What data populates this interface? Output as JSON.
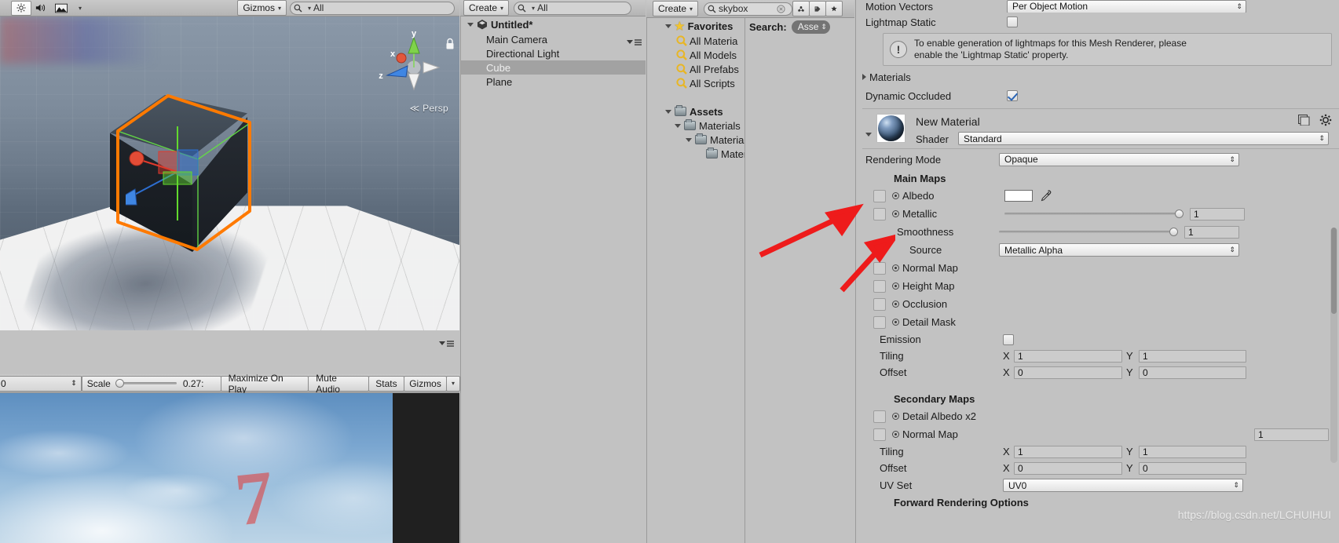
{
  "scene_toolbar": {
    "lighting_icon": "sun-icon",
    "audio_icon": "speaker-icon",
    "fx_icon": "image-icon",
    "fx_caret": "▾",
    "gizmos_label": "Gizmos",
    "gizmos_caret": "▾",
    "search_placeholder": "All",
    "search_value": "",
    "search_icon": "search-icon"
  },
  "scene_view": {
    "projection_label": "Persp",
    "projection_prefix": "≪",
    "axis_x": "x",
    "axis_y": "y",
    "axis_z": "z",
    "selection_color": "#ff7a00",
    "wire_color": "#66dd44"
  },
  "game_toolbar": {
    "display_value": "0",
    "scale_label": "Scale",
    "scale_value": "0.27:",
    "maximize_label": "Maximize On Play",
    "mute_label": "Mute Audio",
    "stats_label": "Stats",
    "gizmos_label": "Gizmos",
    "gizmos_caret": "▾",
    "options_icon": "panel-options-icon"
  },
  "game_view": {
    "overlay_number": "7"
  },
  "hierarchy": {
    "create_label": "Create",
    "create_caret": "▾",
    "search_placeholder": "All",
    "search_icon": "search-icon",
    "options_icon": "panel-options-icon",
    "scene_name": "Untitled*",
    "scene_icon": "unity-scene-icon",
    "items": [
      {
        "label": "Main Camera",
        "selected": false
      },
      {
        "label": "Directional Light",
        "selected": false
      },
      {
        "label": "Cube",
        "selected": true
      },
      {
        "label": "Plane",
        "selected": false
      }
    ]
  },
  "project": {
    "create_label": "Create",
    "create_caret": "▾",
    "search_value": "skybox",
    "search_icon": "search-icon",
    "search_clear_icon": "clear-circle-icon",
    "icons": [
      {
        "name": "filter-type-icon",
        "glyph": "⚛"
      },
      {
        "name": "filter-label-icon",
        "glyph": "🏷"
      },
      {
        "name": "filter-favorite-icon",
        "glyph": "★"
      }
    ],
    "favorites_label": "Favorites",
    "favorites_icon": "star-icon",
    "favorites": [
      {
        "label": "All Materia",
        "icon": "saved-search-icon"
      },
      {
        "label": "All Models",
        "icon": "saved-search-icon"
      },
      {
        "label": "All Prefabs",
        "icon": "saved-search-icon"
      },
      {
        "label": "All Scripts",
        "icon": "saved-search-icon"
      }
    ],
    "assets_label": "Assets",
    "tree": [
      {
        "label": "Materials",
        "depth": 1,
        "expanded": true
      },
      {
        "label": "Materials",
        "depth": 2,
        "expanded": true
      },
      {
        "label": "Mater",
        "depth": 3,
        "expanded": false
      }
    ],
    "search_header_label": "Search:",
    "search_scope": "Asse",
    "search_scope_caret": "⇕"
  },
  "inspector": {
    "motion_vectors": {
      "label": "Motion Vectors",
      "value": "Per Object Motion"
    },
    "lightmap_static": {
      "label": "Lightmap Static",
      "checked": false
    },
    "help_box": {
      "icon": "warning-icon",
      "line1": "To enable generation of lightmaps for this Mesh Renderer, please",
      "line2": "enable the 'Lightmap Static' property."
    },
    "materials_foldout": {
      "label": "Materials",
      "expanded": false
    },
    "dynamic_occluded": {
      "label": "Dynamic Occluded",
      "checked": true
    },
    "material": {
      "name": "New Material",
      "preview_icon": "material-sphere-preview",
      "settings_icon": "gear-icon",
      "preset_icon": "preset-icon",
      "shader_label": "Shader",
      "shader_value": "Standard",
      "rendering_mode_label": "Rendering Mode",
      "rendering_mode_value": "Opaque",
      "main_maps_label": "Main Maps",
      "albedo": {
        "label": "Albedo",
        "color": "#ffffff",
        "eyedropper_icon": "eyedropper-icon"
      },
      "metallic": {
        "label": "Metallic",
        "value": "1",
        "slider_pct": 100
      },
      "smoothness": {
        "label": "Smoothness",
        "value": "1",
        "slider_pct": 100
      },
      "source": {
        "label": "Source",
        "value": "Metallic Alpha"
      },
      "normal_map_label": "Normal Map",
      "height_map_label": "Height Map",
      "occlusion_label": "Occlusion",
      "detail_mask_label": "Detail Mask",
      "emission": {
        "label": "Emission",
        "checked": false
      },
      "tiling": {
        "label": "Tiling",
        "x_label": "X",
        "x": "1",
        "y_label": "Y",
        "y": "1"
      },
      "offset": {
        "label": "Offset",
        "x_label": "X",
        "x": "0",
        "y_label": "Y",
        "y": "0"
      },
      "secondary_maps_label": "Secondary Maps",
      "detail_albedo_label": "Detail Albedo x2",
      "secondary_normal": {
        "label": "Normal Map",
        "value": "1"
      },
      "tiling2": {
        "label": "Tiling",
        "x_label": "X",
        "x": "1",
        "y_label": "Y",
        "y": "1"
      },
      "offset2": {
        "label": "Offset",
        "x_label": "X",
        "x": "0",
        "y_label": "Y",
        "y": "0"
      },
      "uv_set": {
        "label": "UV Set",
        "value": "UV0"
      },
      "forward_rendering_label": "Forward Rendering Options"
    }
  },
  "watermark": {
    "text": "https://blog.csdn.net/LCHUIHUI"
  }
}
